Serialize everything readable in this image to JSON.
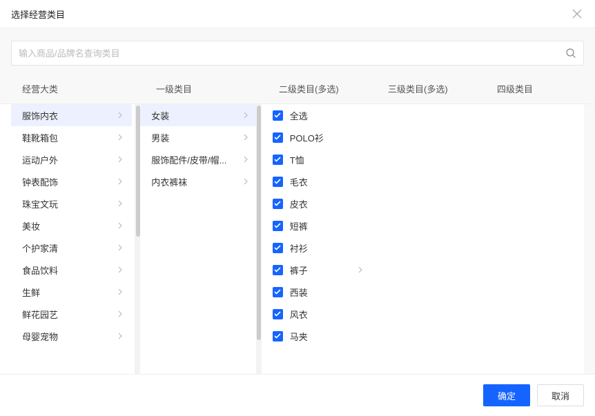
{
  "modal": {
    "title": "选择经营类目",
    "close_label": "关闭"
  },
  "search": {
    "placeholder": "输入商品/品牌名查询类目"
  },
  "columns": {
    "headers": [
      "经营大类",
      "一级类目",
      "二级类目(多选)",
      "三级类目(多选)",
      "四级类目"
    ]
  },
  "col0": {
    "items": [
      {
        "label": "服饰内衣",
        "selected": true
      },
      {
        "label": "鞋靴箱包",
        "selected": false
      },
      {
        "label": "运动户外",
        "selected": false
      },
      {
        "label": "钟表配饰",
        "selected": false
      },
      {
        "label": "珠宝文玩",
        "selected": false
      },
      {
        "label": "美妆",
        "selected": false
      },
      {
        "label": "个护家清",
        "selected": false
      },
      {
        "label": "食品饮料",
        "selected": false
      },
      {
        "label": "生鲜",
        "selected": false
      },
      {
        "label": "鲜花园艺",
        "selected": false
      },
      {
        "label": "母婴宠物",
        "selected": false
      }
    ]
  },
  "col1": {
    "items": [
      {
        "label": "女装",
        "selected": true
      },
      {
        "label": "男装",
        "selected": false
      },
      {
        "label": "服饰配件/皮带/帽...",
        "selected": false
      },
      {
        "label": "内衣裤袜",
        "selected": false
      }
    ]
  },
  "col2": {
    "items": [
      {
        "label": "全选",
        "checked": true,
        "has_children": false
      },
      {
        "label": "POLO衫",
        "checked": true,
        "has_children": false
      },
      {
        "label": "T恤",
        "checked": true,
        "has_children": false
      },
      {
        "label": "毛衣",
        "checked": true,
        "has_children": false
      },
      {
        "label": "皮衣",
        "checked": true,
        "has_children": false
      },
      {
        "label": "短裤",
        "checked": true,
        "has_children": false
      },
      {
        "label": "衬衫",
        "checked": true,
        "has_children": false
      },
      {
        "label": "裤子",
        "checked": true,
        "has_children": true
      },
      {
        "label": "西装",
        "checked": true,
        "has_children": false
      },
      {
        "label": "风衣",
        "checked": true,
        "has_children": false
      },
      {
        "label": "马夹",
        "checked": true,
        "has_children": false
      }
    ]
  },
  "footer": {
    "confirm": "确定",
    "cancel": "取消"
  }
}
